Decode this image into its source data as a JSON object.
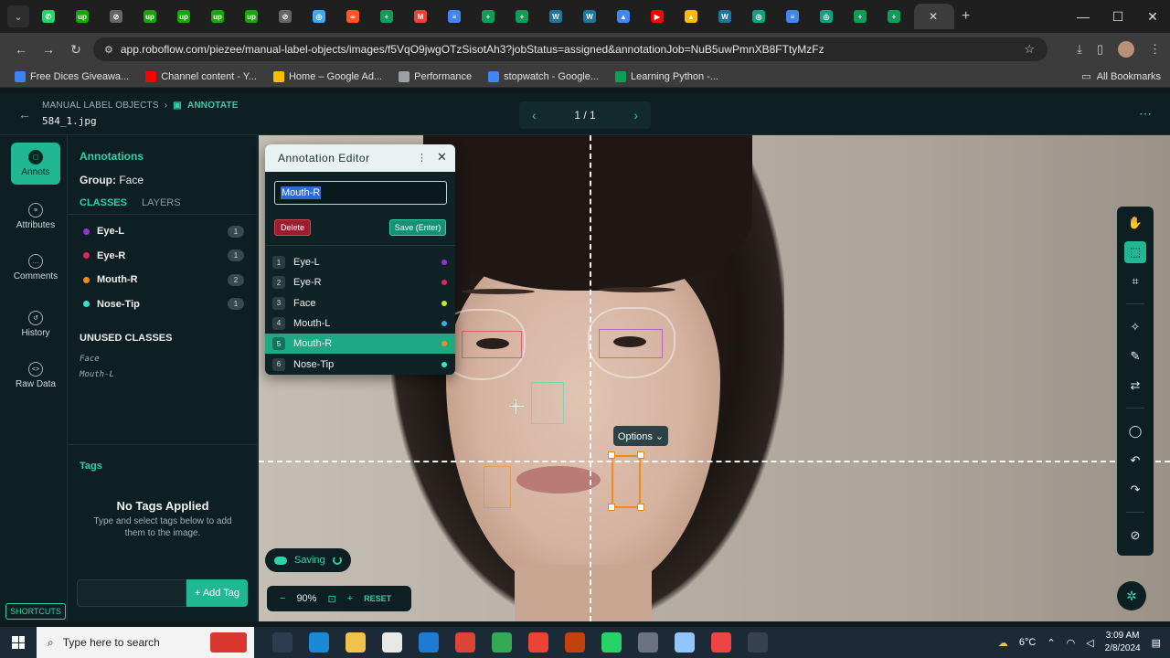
{
  "browser": {
    "url": "app.roboflow.com/piezee/manual-label-objects/images/f5VqO9jwgOTzSisotAh3?jobStatus=assigned&annotationJob=NuB5uwPmnXB8FTtyMzFz",
    "tab_favicons": [
      {
        "color": "#25d366",
        "glyph": "✆"
      },
      {
        "color": "#14a800",
        "glyph": "up"
      },
      {
        "color": "#666666",
        "glyph": "⊘"
      },
      {
        "color": "#14a800",
        "glyph": "up"
      },
      {
        "color": "#14a800",
        "glyph": "up"
      },
      {
        "color": "#14a800",
        "glyph": "up"
      },
      {
        "color": "#14a800",
        "glyph": "up"
      },
      {
        "color": "#666666",
        "glyph": "⊘"
      },
      {
        "color": "#3fa9f5",
        "glyph": "◎"
      },
      {
        "color": "#ff5722",
        "glyph": "∞"
      },
      {
        "color": "#0f9d58",
        "glyph": "+"
      },
      {
        "color": "#ea4335",
        "glyph": "M"
      },
      {
        "color": "#4285f4",
        "glyph": "≡"
      },
      {
        "color": "#0f9d58",
        "glyph": "+"
      },
      {
        "color": "#0f9d58",
        "glyph": "+"
      },
      {
        "color": "#21759b",
        "glyph": "W"
      },
      {
        "color": "#21759b",
        "glyph": "W"
      },
      {
        "color": "#4285f4",
        "glyph": "▲"
      },
      {
        "color": "#ff0000",
        "glyph": "▶"
      },
      {
        "color": "#fbbc04",
        "glyph": "▲"
      },
      {
        "color": "#21759b",
        "glyph": "W"
      },
      {
        "color": "#10a37f",
        "glyph": "◎"
      },
      {
        "color": "#4285f4",
        "glyph": "≡"
      },
      {
        "color": "#10a37f",
        "glyph": "◎"
      },
      {
        "color": "#0f9d58",
        "glyph": "+"
      },
      {
        "color": "#0f9d58",
        "glyph": "+"
      }
    ],
    "bookmarks": [
      {
        "label": "Free Dices Giveawa...",
        "color": "#3b82f6"
      },
      {
        "label": "Channel content - Y...",
        "color": "#ff0000"
      },
      {
        "label": "Home – Google Ad...",
        "color": "#fbbc04"
      },
      {
        "label": "Performance",
        "color": "#9aa0a6"
      },
      {
        "label": "stopwatch - Google...",
        "color": "#4285f4"
      },
      {
        "label": "Learning Python -...",
        "color": "#0f9d58"
      }
    ],
    "all_bookmarks": "All Bookmarks"
  },
  "header": {
    "breadcrumb_parent": "MANUAL LABEL OBJECTS",
    "breadcrumb_current": "ANNOTATE",
    "filename": "584_1.jpg",
    "page_counter": "1 / 1"
  },
  "rail": {
    "items": [
      {
        "label": "Annots",
        "glyph": "▢"
      },
      {
        "label": "Attributes",
        "glyph": "≡"
      },
      {
        "label": "Comments",
        "glyph": "…"
      },
      {
        "label": "History",
        "glyph": "↺"
      },
      {
        "label": "Raw Data",
        "glyph": "<>"
      }
    ],
    "shortcuts": "SHORTCUTS"
  },
  "panel": {
    "title": "Annotations",
    "group_label": "Group:",
    "group_value": "Face",
    "tabs": [
      "CLASSES",
      "LAYERS"
    ],
    "classes": [
      {
        "name": "Eye-L",
        "count": "1",
        "color": "#9b30d9"
      },
      {
        "name": "Eye-R",
        "count": "1",
        "color": "#e0245e"
      },
      {
        "name": "Mouth-R",
        "count": "2",
        "color": "#f28a1a"
      },
      {
        "name": "Nose-Tip",
        "count": "1",
        "color": "#2ee6c9"
      }
    ],
    "unused_title": "UNUSED CLASSES",
    "unused": [
      "Face",
      "Mouth-L"
    ],
    "tags_title": "Tags",
    "no_tags": "No Tags Applied",
    "no_tags_sub": "Type and select tags below to add them to the image.",
    "add_tag": "+ Add Tag"
  },
  "editor": {
    "title": "Annotation Editor",
    "input_value": "Mouth-R",
    "delete_label": "Delete",
    "save_label": "Save (Enter)",
    "classes": [
      {
        "num": "1",
        "name": "Eye-L",
        "color": "#9b30d9"
      },
      {
        "num": "2",
        "name": "Eye-R",
        "color": "#e0245e"
      },
      {
        "num": "3",
        "name": "Face",
        "color": "#c8e62e"
      },
      {
        "num": "4",
        "name": "Mouth-L",
        "color": "#3aaed8"
      },
      {
        "num": "5",
        "name": "Mouth-R",
        "color": "#f28a1a"
      },
      {
        "num": "6",
        "name": "Nose-Tip",
        "color": "#2ee6c9"
      }
    ],
    "selected_class": "Mouth-R"
  },
  "canvas": {
    "options_label": "Options ⌄",
    "saving_label": "Saving",
    "zoom": "90%",
    "reset_label": "RESET"
  },
  "taskbar": {
    "search_placeholder": "Type here to search",
    "weather": "6°C",
    "time": "3:09 AM",
    "date": "2/8/2024"
  },
  "colors": {
    "accent": "#1fb892",
    "accent_text": "#2ad3a9",
    "panel_bg": "#0d1f22"
  }
}
